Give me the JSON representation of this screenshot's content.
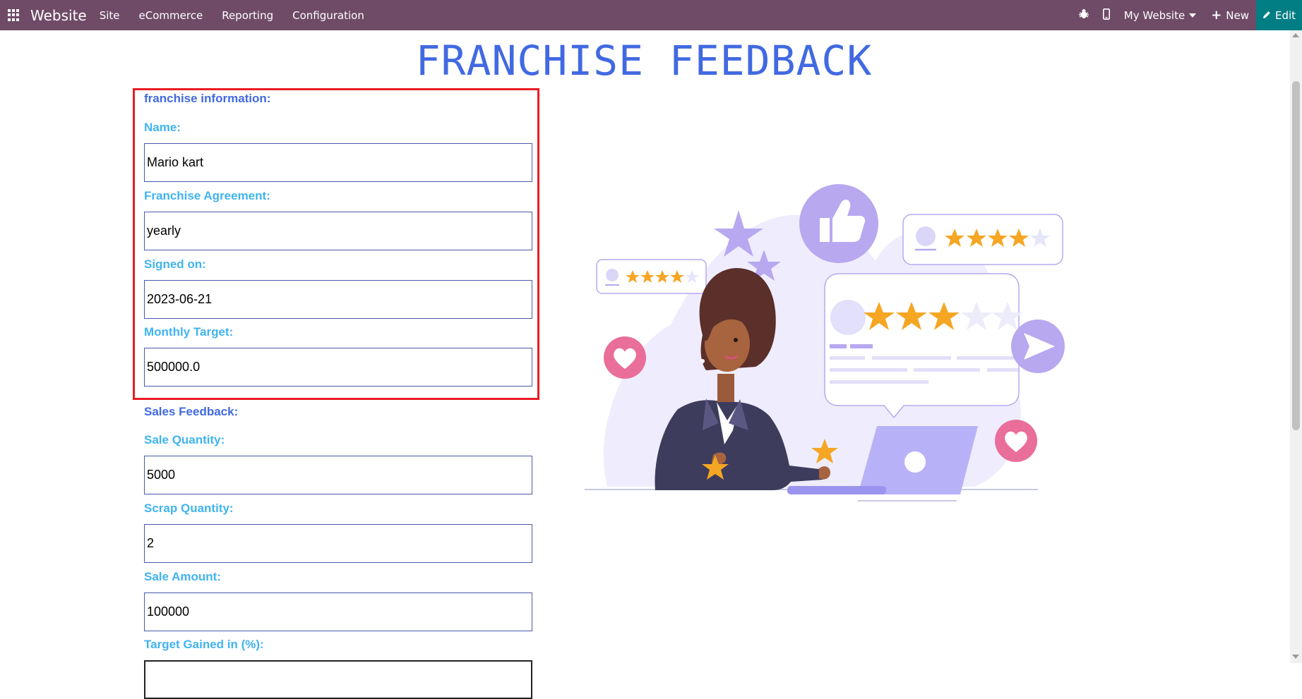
{
  "navbar": {
    "brand": "Website",
    "menu": [
      "Site",
      "eCommerce",
      "Reporting",
      "Configuration"
    ],
    "my_website": "My Website",
    "new_label": "New",
    "edit_label": "Edit"
  },
  "page": {
    "title": "FRANCHISE FEEDBACK",
    "franchise_section": "franchise information:",
    "name_label": "Name:",
    "name_value": "Mario kart",
    "agreement_label": "Franchise Agreement:",
    "agreement_value": "yearly",
    "signed_label": "Signed on:",
    "signed_value": "2023-06-21",
    "target_label": "Monthly Target:",
    "target_value": "500000.0",
    "sales_section": "Sales Feedback:",
    "sale_qty_label": "Sale Quantity:",
    "sale_qty_value": "5000",
    "scrap_qty_label": "Scrap Quantity:",
    "scrap_qty_value": "2",
    "sale_amount_label": "Sale Amount:",
    "sale_amount_value": "100000",
    "target_gained_label": "Target Gained in (%):",
    "target_gained_value": ""
  },
  "colors": {
    "navbar": "#6f4b68",
    "edit": "#017e84",
    "title": "#4169e1",
    "section": "#4169e1",
    "label": "#40b4f0",
    "highlight": "#e81c24",
    "star": "#f5a623",
    "purple": "#b8a8f0"
  },
  "icons": [
    "apps-grid-icon",
    "bug-icon",
    "mobile-icon",
    "caret-down-icon",
    "plus-icon",
    "pencil-icon"
  ]
}
